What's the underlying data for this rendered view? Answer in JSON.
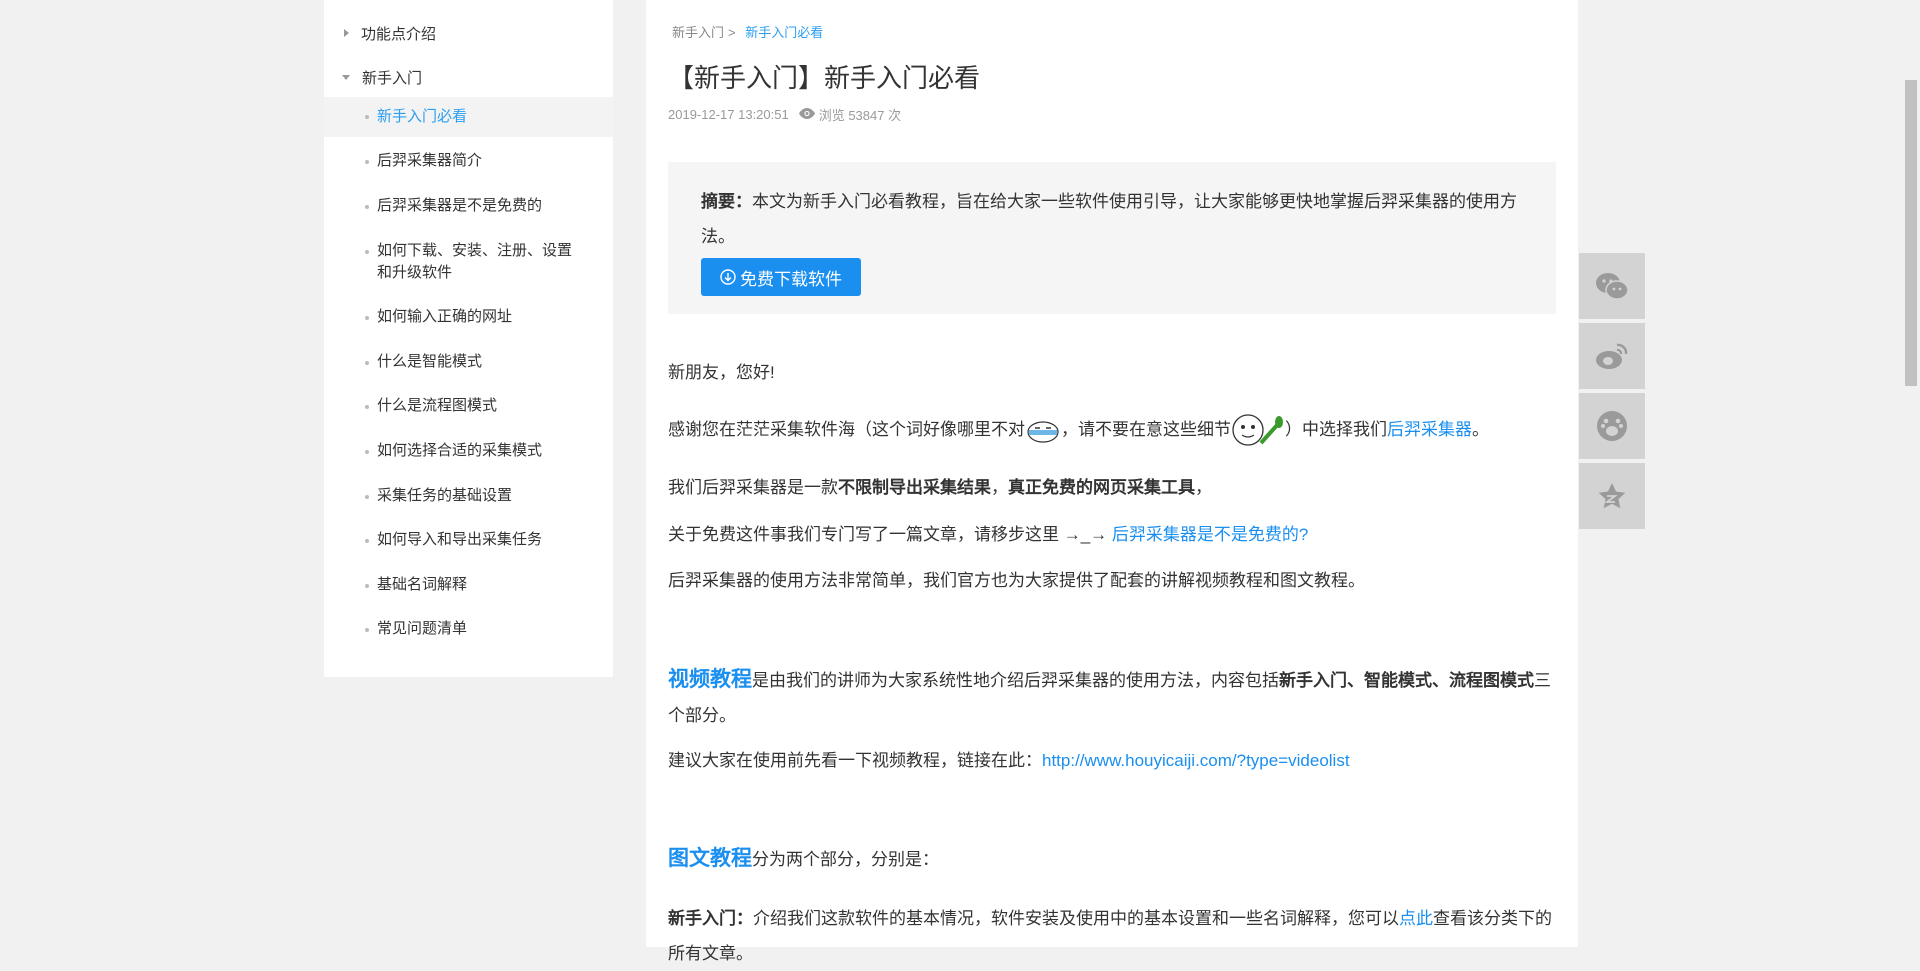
{
  "sidebar": {
    "groups": [
      {
        "label": "功能点介绍"
      },
      {
        "label": "新手入门"
      }
    ],
    "items": [
      {
        "label": "新手入门必看"
      },
      {
        "label": "后羿采集器简介"
      },
      {
        "label": "后羿采集器是不是免费的"
      },
      {
        "label": "如何下载、安装、注册、设置和升级软件"
      },
      {
        "label": "如何输入正确的网址"
      },
      {
        "label": "什么是智能模式"
      },
      {
        "label": "什么是流程图模式"
      },
      {
        "label": "如何选择合适的采集模式"
      },
      {
        "label": "采集任务的基础设置"
      },
      {
        "label": "如何导入和导出采集任务"
      },
      {
        "label": "基础名词解释"
      },
      {
        "label": "常见问题清单"
      }
    ]
  },
  "article": {
    "breadcrumb": {
      "parent": "新手入门",
      "sep": ">",
      "current": "新手入门必看"
    },
    "title": "【新手入门】新手入门必看",
    "date": "2019-12-17 13:20:51",
    "views": "浏览 53847 次",
    "summary": {
      "label": "摘要：",
      "text": "本文为新手入门必看教程，旨在给大家一些软件使用引导，让大家能够更快地掌握后羿采集器的使用方法。",
      "download_button": "免费下载软件"
    },
    "p1": "新朋友，您好!",
    "p2": {
      "a": "感谢您在茫茫采集软件海（这个词好像哪里不对",
      "b": "，请不要在意这些细节",
      "c": "）中选择我们",
      "link": "后羿采集器",
      "d": "。"
    },
    "p3": {
      "a": "我们后羿采集器是一款",
      "b1": "不限制导出采集结果",
      "c": "，",
      "b2": "真正免费的网页采集工具",
      "d": "，"
    },
    "p4": {
      "a": "关于免费这件事我们专门写了一篇文章，请移步这里 →_→ ",
      "link": "后羿采集器是不是免费的?"
    },
    "p5": "后羿采集器的使用方法非常简单，我们官方也为大家提供了配套的讲解视频教程和图文教程。",
    "video": {
      "head": "视频教程",
      "text": "是由我们的讲师为大家系统性地介绍后羿采集器的使用方法，内容包括",
      "bold": "新手入门、智能模式、流程图模式",
      "tail": "三个部分。"
    },
    "video_link": {
      "a": "建议大家在使用前先看一下视频教程，链接在此：",
      "link": "http://www.houyicaiji.com/?type=videolist"
    },
    "graphic": {
      "head": "图文教程",
      "text": "分为两个部分，分别是："
    },
    "newbie": {
      "bold": "新手入门：",
      "text": "介绍我们这款软件的基本情况，软件安装及使用中的基本设置和一些名词解释，您可以",
      "link": "点此",
      "tail": "查看该分类下的所有文章。"
    }
  },
  "share": [
    "wechat-icon",
    "weibo-icon",
    "baidu-icon",
    "favorite-icon"
  ]
}
